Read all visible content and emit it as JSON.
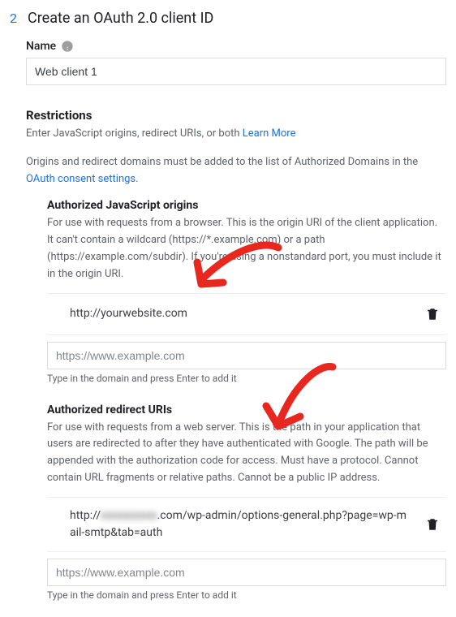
{
  "step": {
    "number": "2",
    "title": "Create an OAuth 2.0 client ID"
  },
  "name_field": {
    "label": "Name",
    "value": "Web client 1"
  },
  "restrictions": {
    "heading": "Restrictions",
    "intro_text": "Enter JavaScript origins, redirect URIs, or both ",
    "learn_more": "Learn More",
    "domains_text_a": "Origins and redirect domains must be added to the list of Authorized Domains in the ",
    "consent_link": "OAuth consent settings",
    "domains_text_b": "."
  },
  "js_origins": {
    "heading": "Authorized JavaScript origins",
    "desc": "For use with requests from a browser. This is the origin URI of the client application. It can't contain a wildcard (https://*.example.com) or a path (https://example.com/subdir). If you're using a nonstandard port, you must include it in the origin URI.",
    "entry": "http://yourwebsite.com",
    "placeholder": "https://www.example.com",
    "hint": "Type in the domain and press Enter to add it"
  },
  "redirect_uris": {
    "heading": "Authorized redirect URIs",
    "desc": "For use with requests from a web server. This is the path in your application that users are redirected to after they have authenticated with Google. The path will be appended with the authorization code for access. Must have a protocol. Cannot contain URL fragments or relative paths. Cannot be a public IP address.",
    "entry_prefix": "http://",
    "entry_mask": "xxxxxxxxxx",
    "entry_suffix": ".com/wp-admin/options-general.php?page=wp-mail-smtp&tab=auth",
    "placeholder": "https://www.example.com",
    "hint": "Type in the domain and press Enter to add it"
  },
  "icons": {
    "help": "help-icon",
    "trash": "trash-icon"
  },
  "annotation_color": "#e8281f"
}
